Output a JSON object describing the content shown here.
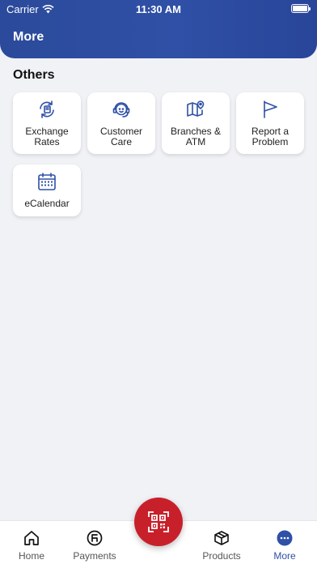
{
  "status_bar": {
    "carrier": "Carrier",
    "time": "11:30 AM"
  },
  "header": {
    "title": "More"
  },
  "section": {
    "title": "Others"
  },
  "tiles": [
    {
      "label": "Exchange\nRates",
      "icon": "exchange-rates-icon"
    },
    {
      "label": "Customer\nCare",
      "icon": "customer-care-icon"
    },
    {
      "label": "Branches &\nATM",
      "icon": "map-pin-icon"
    },
    {
      "label": "Report a\nProblem",
      "icon": "flag-icon"
    },
    {
      "label": "eCalendar",
      "icon": "calendar-icon"
    }
  ],
  "tabs": [
    {
      "label": "Home",
      "icon": "home-icon"
    },
    {
      "label": "Payments",
      "icon": "payments-icon"
    },
    {
      "label": "Products",
      "icon": "box-icon"
    },
    {
      "label": "More",
      "icon": "more-icon",
      "active": true
    }
  ],
  "colors": {
    "primary": "#2F50A6",
    "accent": "#C8202A",
    "background": "#F1F2F6"
  }
}
